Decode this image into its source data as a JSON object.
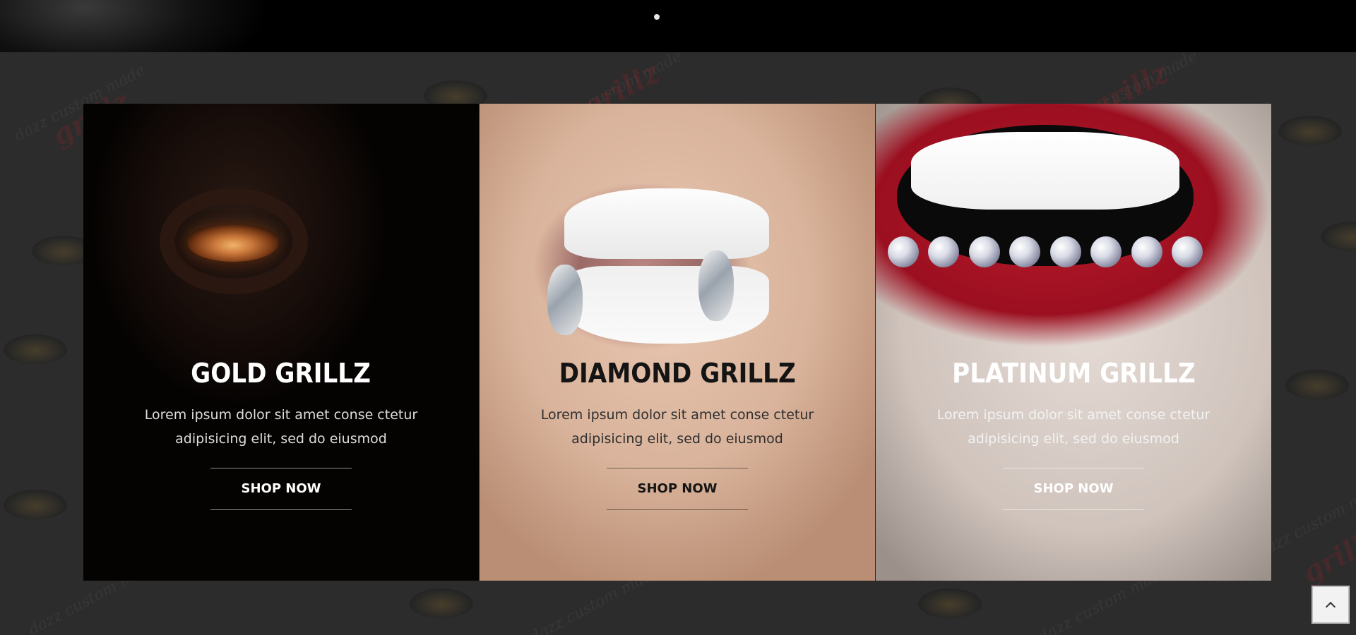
{
  "hero": {
    "slider_dots": 1,
    "active_dot": 1
  },
  "background": {
    "watermark_text": "dazz custom made",
    "watermark_logo": "grillz"
  },
  "cards": [
    {
      "title": "GOLD GRILLZ",
      "description": "Lorem ipsum dolor sit amet conse ctetur adipisicing elit, sed do eiusmod",
      "button": "SHOP NOW",
      "image": "gold-grillz-photo"
    },
    {
      "title": "DIAMOND GRILLZ",
      "description": "Lorem ipsum dolor sit amet conse ctetur adipisicing elit, sed do eiusmod",
      "button": "SHOP NOW",
      "image": "diamond-grillz-photo"
    },
    {
      "title": "PLATINUM GRILLZ",
      "description": "Lorem ipsum dolor sit amet conse ctetur adipisicing elit, sed do eiusmod",
      "button": "SHOP NOW",
      "image": "platinum-grillz-photo"
    }
  ],
  "scroll_top": {
    "icon": "chevron-up-icon"
  }
}
